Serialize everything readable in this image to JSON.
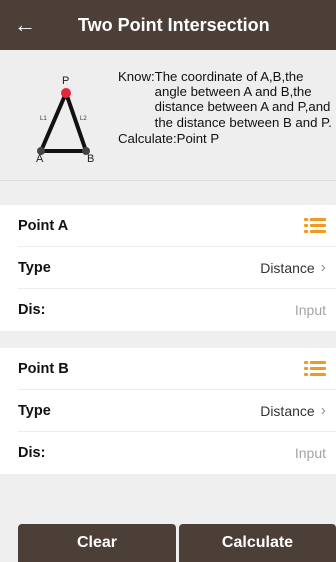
{
  "header": {
    "back_icon": "arrow-left-icon",
    "title": "Two Point Intersection"
  },
  "info": {
    "diagram": {
      "label_p": "P",
      "label_a": "A",
      "label_b": "B",
      "label_l1": "L1",
      "label_l2": "L2"
    },
    "know_label": "Know:",
    "know_text": "The coordinate of A,B,the angle between A and B,the distance between A and P,and the distance between B and P.",
    "calculate_line": "Calculate:Point P"
  },
  "point_a": {
    "label": "Point A",
    "type_label": "Type",
    "type_value": "Distance",
    "dis_label": "Dis:",
    "dis_placeholder": "Input"
  },
  "point_b": {
    "label": "Point B",
    "type_label": "Type",
    "type_value": "Distance",
    "dis_label": "Dis:",
    "dis_placeholder": "Input"
  },
  "footer": {
    "clear_label": "Clear",
    "calculate_label": "Calculate"
  },
  "colors": {
    "appbar": "#4c3f37",
    "accent": "#f19a1f",
    "point": "#e8243b"
  }
}
